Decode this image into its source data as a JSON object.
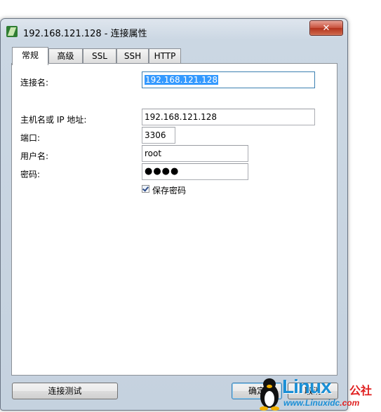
{
  "window": {
    "title": "192.168.121.128 - 连接属性",
    "close_label": "✕"
  },
  "tabs": [
    {
      "label": "常规",
      "active": true
    },
    {
      "label": "高级",
      "active": false
    },
    {
      "label": "SSL",
      "active": false
    },
    {
      "label": "SSH",
      "active": false
    },
    {
      "label": "HTTP",
      "active": false
    }
  ],
  "form": {
    "connection_name_label": "连接名:",
    "connection_name_value": "192.168.121.128",
    "host_label": "主机名或 IP 地址:",
    "host_value": "192.168.121.128",
    "port_label": "端口:",
    "port_value": "3306",
    "username_label": "用户名:",
    "username_value": "root",
    "password_label": "密码:",
    "password_value": "●●●●",
    "save_password_label": "保存密码",
    "save_password_checked": true
  },
  "footer": {
    "test_button_label": "连接测试",
    "ok_button_label": "确定",
    "cancel_button_label": "取消"
  },
  "watermark": {
    "brand": "Linux",
    "suffix": "公社",
    "url_prefix": "www.Linuxidc",
    "url_domain": ".com"
  }
}
